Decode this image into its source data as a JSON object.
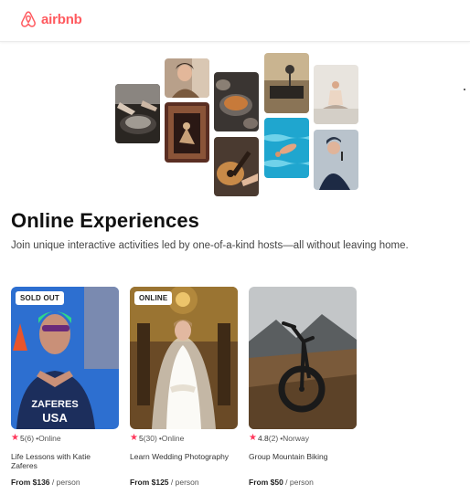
{
  "brand": {
    "name": "airbnb",
    "color": "#ff5a5f"
  },
  "hero": {
    "title": "Online Experiences",
    "subtitle": "Join unique interactive activities led by one-of-a-kind hosts—all without leaving home."
  },
  "listings": [
    {
      "badge": "SOLD OUT",
      "rating": "5",
      "reviews": "(6)",
      "location": "•Online",
      "title": "Life Lessons with Katie Zaferes",
      "price": "From $136",
      "per": " / person"
    },
    {
      "badge": "ONLINE",
      "rating": "5",
      "reviews": "(30)",
      "location": "•Online",
      "title": "Learn Wedding Photography",
      "price": "From $125",
      "per": " / person"
    },
    {
      "badge": "",
      "rating": "4.8",
      "reviews": "(2)",
      "location": "•Norway",
      "title": "Group Mountain Biking",
      "price": "From $50",
      "per": " / person"
    }
  ],
  "card1_jersey": {
    "line1": "ZAFERES",
    "line2": "USA"
  },
  "icons": {
    "logo": "airbnb-logo-icon",
    "star": "star-icon"
  }
}
